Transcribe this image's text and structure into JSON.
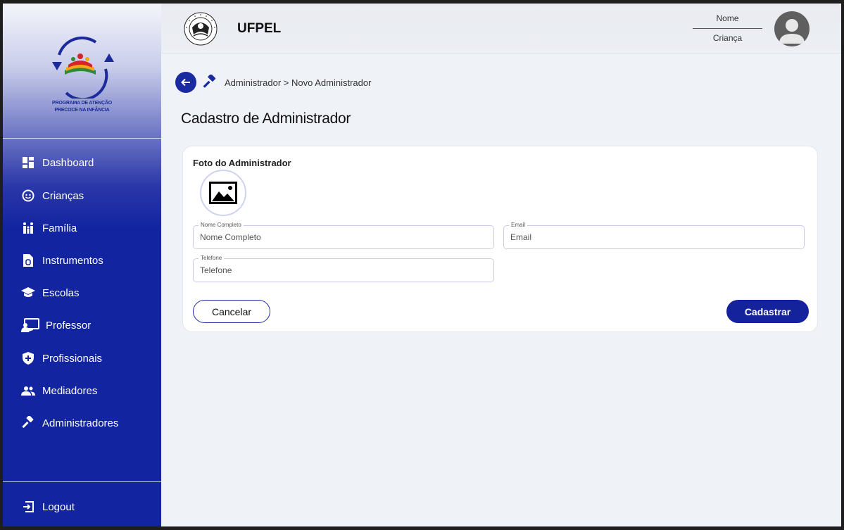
{
  "app": {
    "logo_text_line1": "PROGRAMA DE ATENÇÃO",
    "logo_text_line2": "PRECOCE NA INFÂNCIA",
    "brand": "UFPEL",
    "seal_text_top": "UNIVERSIDADE FEDERAL DE PELOTAS",
    "seal_text_bottom": "RS BRASIL"
  },
  "colors": {
    "primary": "#14239b",
    "sidebar": "#1224a0",
    "background": "#eff2f7"
  },
  "sidebar": {
    "items": [
      {
        "label": "Dashboard",
        "icon": "dashboard-icon"
      },
      {
        "label": "Crianças",
        "icon": "child-face-icon"
      },
      {
        "label": "Família",
        "icon": "family-icon"
      },
      {
        "label": "Instrumentos",
        "icon": "document-icon"
      },
      {
        "label": "Escolas",
        "icon": "school-cap-icon"
      },
      {
        "label": "Professor",
        "icon": "teacher-icon"
      },
      {
        "label": "Profissionais",
        "icon": "shield-plus-icon"
      },
      {
        "label": "Mediadores",
        "icon": "group-icon"
      },
      {
        "label": "Administradores",
        "icon": "gavel-icon"
      }
    ],
    "logout": {
      "label": "Logout",
      "icon": "logout-icon"
    }
  },
  "header": {
    "user_name": "Nome",
    "user_role": "Criança"
  },
  "breadcrumb": {
    "text": "Administrador > Novo Administrador"
  },
  "page": {
    "title": "Cadastro de Administrador"
  },
  "form": {
    "photo_label": "Foto do Administrador",
    "full_name": {
      "label": "Nome Completo",
      "placeholder": "Nome Completo",
      "value": ""
    },
    "email": {
      "label": "Email",
      "placeholder": "Email",
      "value": ""
    },
    "phone": {
      "label": "Telefone",
      "placeholder": "Telefone",
      "value": ""
    },
    "cancel_label": "Cancelar",
    "submit_label": "Cadastrar"
  }
}
